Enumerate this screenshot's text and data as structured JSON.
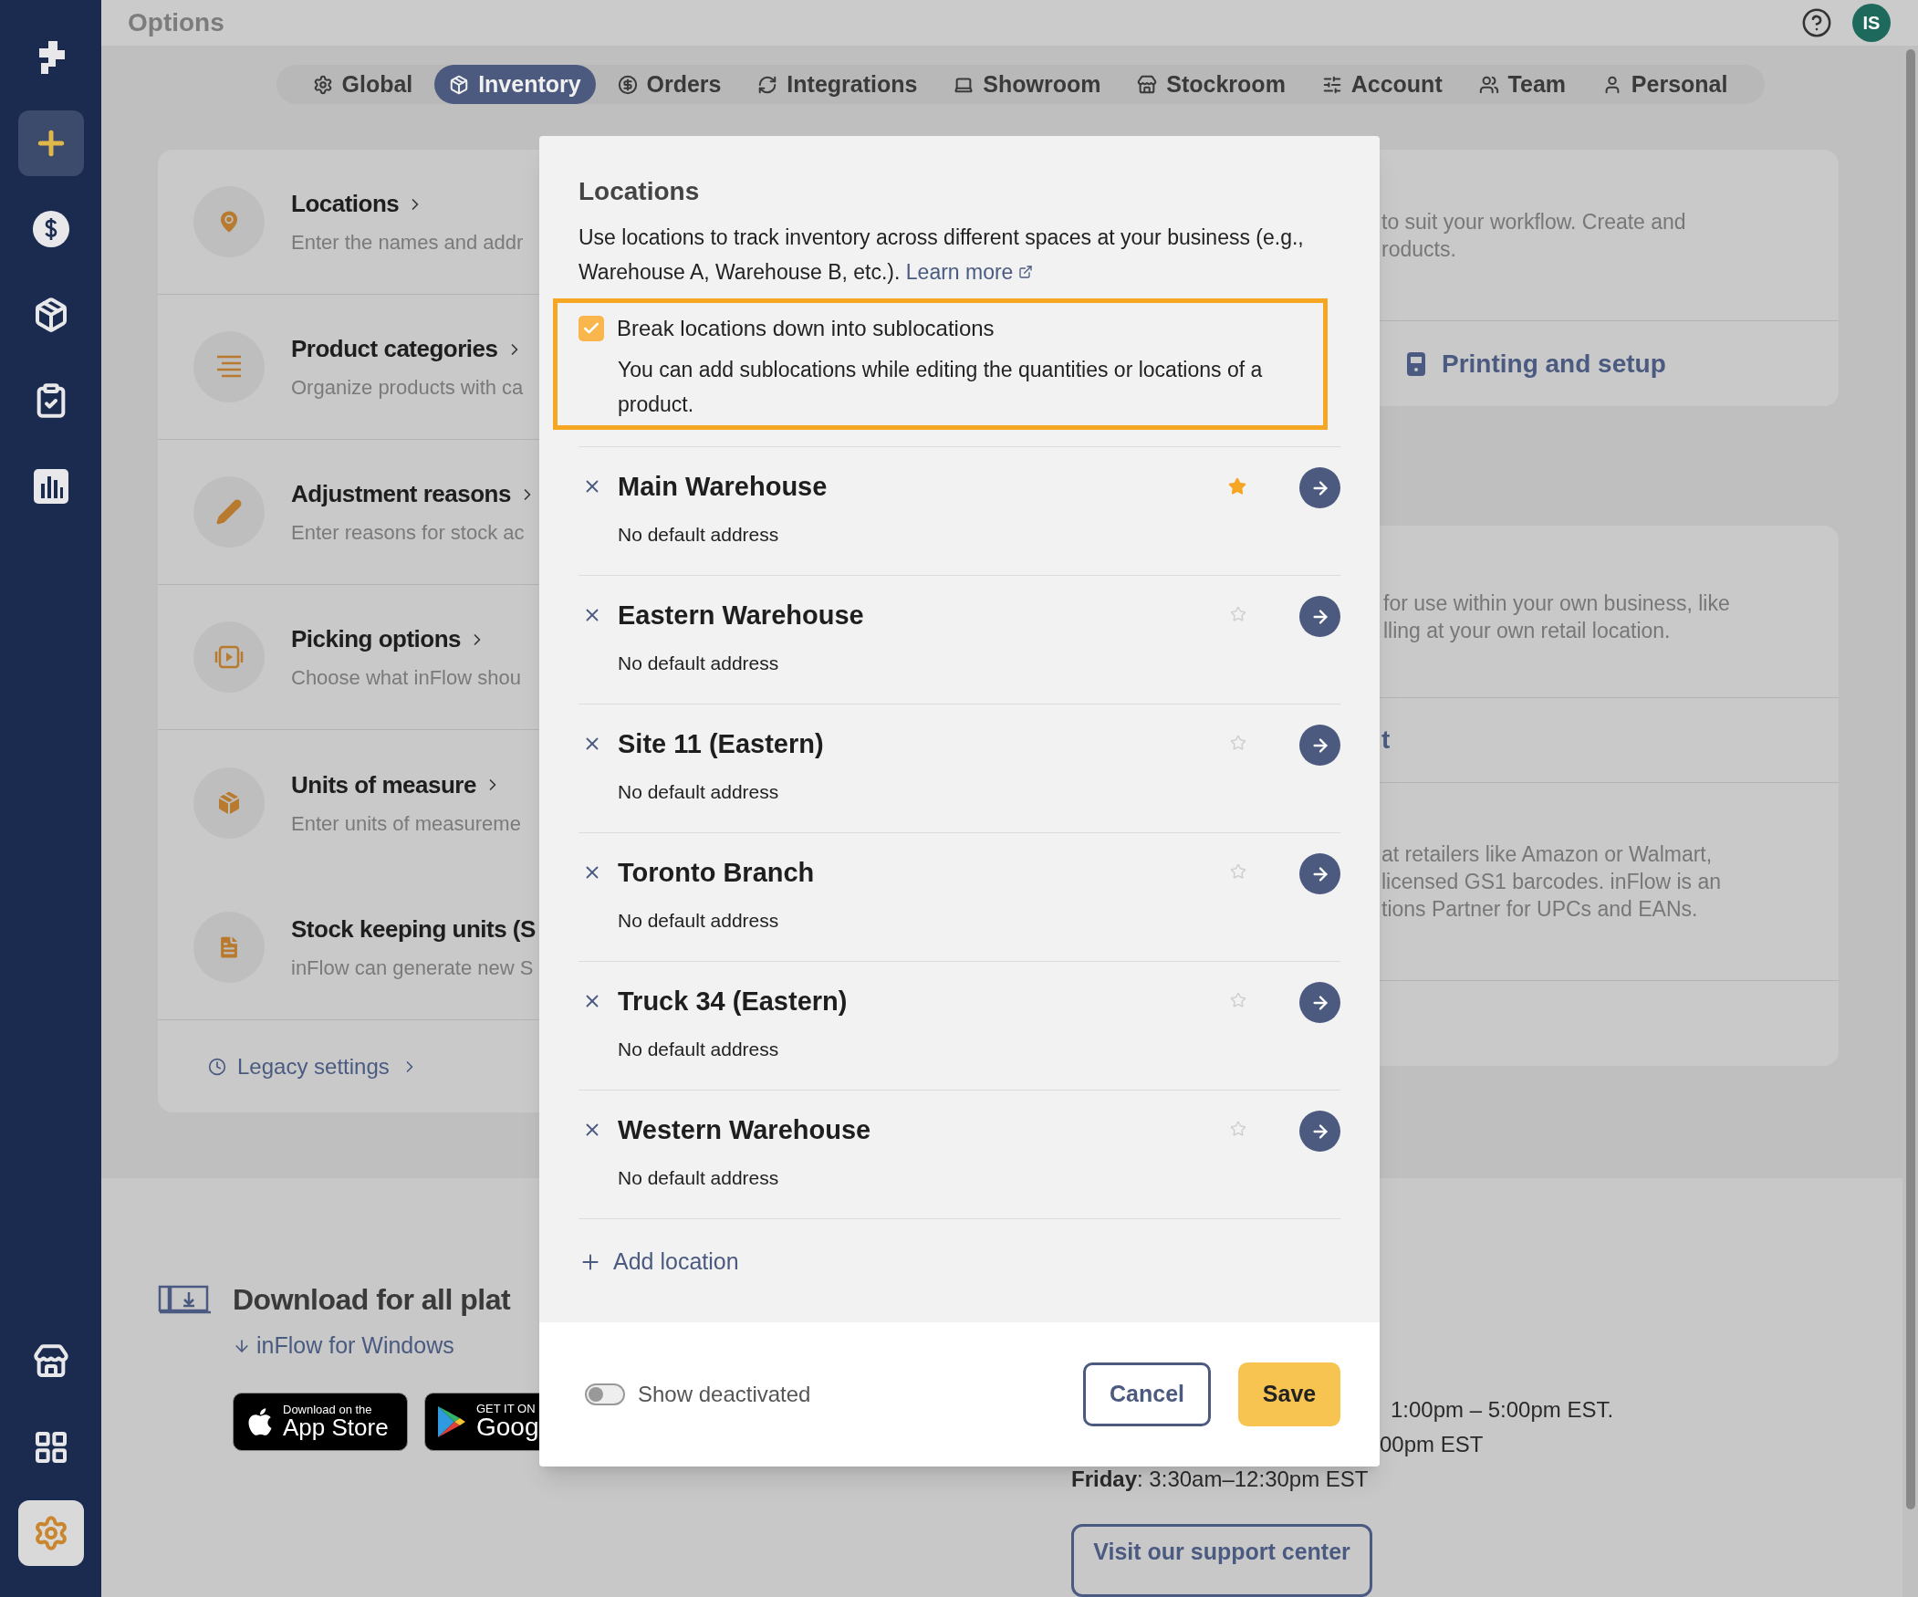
{
  "sidebar": {
    "top_items": [
      {
        "kind": "logo",
        "selected": false
      },
      {
        "kind": "add",
        "selected": true
      },
      {
        "kind": "sales",
        "selected": false
      },
      {
        "kind": "inventory",
        "selected": false
      },
      {
        "kind": "tasks",
        "selected": false
      },
      {
        "kind": "reports",
        "selected": false
      }
    ],
    "bottom_items": [
      {
        "kind": "store",
        "selected": false
      },
      {
        "kind": "apps",
        "selected": false
      },
      {
        "kind": "settings",
        "selected": true
      }
    ]
  },
  "header": {
    "title": "Options",
    "avatar": "IS"
  },
  "tabs": [
    {
      "label": "Global",
      "selected": false
    },
    {
      "label": "Inventory",
      "selected": true
    },
    {
      "label": "Orders",
      "selected": false
    },
    {
      "label": "Integrations",
      "selected": false
    },
    {
      "label": "Showroom",
      "selected": false
    },
    {
      "label": "Stockroom",
      "selected": false
    },
    {
      "label": "Account",
      "selected": false
    },
    {
      "label": "Team",
      "selected": false
    },
    {
      "label": "Personal",
      "selected": false
    }
  ],
  "settings_list": {
    "items": [
      {
        "kind": "location",
        "title": "Locations",
        "description": "Enter the names and addr"
      },
      {
        "kind": "categories",
        "title": "Product categories",
        "description": "Organize products with ca"
      },
      {
        "kind": "adjustment",
        "title": "Adjustment reasons",
        "description": "Enter reasons for stock ac"
      },
      {
        "kind": "picking",
        "title": "Picking options",
        "description": "Choose what inFlow shou"
      },
      {
        "kind": "units",
        "title": "Units of measure",
        "description": "Enter units of measureme"
      },
      {
        "kind": "sku",
        "title": "Stock keeping units (S",
        "description": "inFlow can generate new S"
      }
    ],
    "legacy_link": "Legacy settings"
  },
  "right_panel": {
    "card_1": {
      "lines": [
        "to suit your workflow. Create and",
        "roducts."
      ],
      "link": "Printing and setup"
    },
    "card_2": {
      "lines_1": [
        "for use within your own business, like",
        "lling at your own retail location."
      ],
      "heading": "t",
      "lines_2": [
        "at retailers like Amazon or Walmart,",
        "licensed GS1 barcodes. inFlow is an",
        "tions Partner for UPCs and EANs."
      ]
    }
  },
  "footer": {
    "download_title": "Download for all plat",
    "windows_link": "inFlow for Windows",
    "app_store": {
      "small": "Download on the",
      "large": "App Store"
    },
    "google_play": {
      "small": "GET IT ON",
      "large": "Goog"
    },
    "hours": [
      "1:00pm – 5:00pm EST.",
      "00pm EST",
      "**Friday**: 3:30am–12:30pm EST"
    ],
    "support_button": "Visit our support center"
  },
  "modal": {
    "title": "Locations",
    "description": "Use locations to track inventory across different spaces at your business (e.g., Warehouse A, Warehouse B, etc.).",
    "learn_more": "Learn more",
    "sublocations": {
      "label": "Break locations down into sublocations",
      "checked": true,
      "help": "You can add sublocations while editing the quantities or locations of a product."
    },
    "locations": [
      {
        "name": "Main Warehouse",
        "address": "No default address",
        "default": true
      },
      {
        "name": "Eastern Warehouse",
        "address": "No default address",
        "default": false
      },
      {
        "name": "Site 11 (Eastern)",
        "address": "No default address",
        "default": false
      },
      {
        "name": "Toronto Branch",
        "address": "No default address",
        "default": false
      },
      {
        "name": "Truck 34 (Eastern)",
        "address": "No default address",
        "default": false
      },
      {
        "name": "Western Warehouse",
        "address": "No default address",
        "default": false
      }
    ],
    "add_label": "Add location",
    "show_deactivated": {
      "label": "Show deactivated",
      "on": false
    },
    "cancel": "Cancel",
    "save": "Save"
  }
}
